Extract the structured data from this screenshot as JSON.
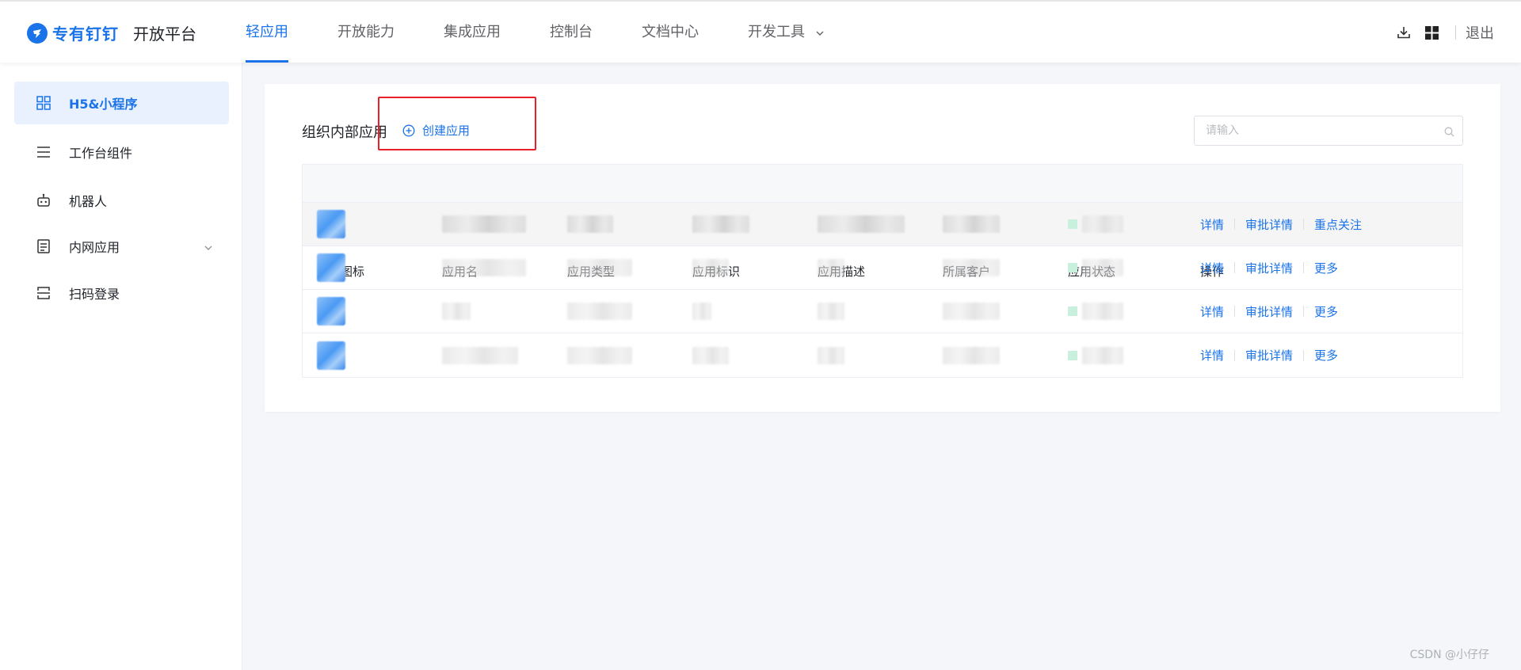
{
  "header": {
    "brand": "专有钉钉",
    "platform": "开放平台",
    "nav": [
      {
        "label": "轻应用",
        "active": true
      },
      {
        "label": "开放能力"
      },
      {
        "label": "集成应用"
      },
      {
        "label": "控制台"
      },
      {
        "label": "文档中心"
      },
      {
        "label": "开发工具",
        "has_dropdown": true
      }
    ],
    "right": {
      "icons": [
        "download-icon",
        "app-grid-icon"
      ],
      "logout": "退出"
    }
  },
  "sidebar": {
    "items": [
      {
        "label": "H5&小程序",
        "icon": "grid-icon",
        "active": true
      },
      {
        "label": "工作台组件",
        "icon": "menu-lines-icon"
      },
      {
        "label": "机器人",
        "icon": "robot-icon"
      },
      {
        "label": "内网应用",
        "icon": "document-icon",
        "expandable": true
      },
      {
        "label": "扫码登录",
        "icon": "scan-icon"
      }
    ]
  },
  "main": {
    "section_title": "组织内部应用",
    "create_button": "创建应用",
    "search": {
      "placeholder": "请输入",
      "value": ""
    },
    "table": {
      "columns": [
        "应用图标",
        "应用名",
        "应用类型",
        "应用标识",
        "应用描述",
        "所属客户",
        "应用状态",
        "操作"
      ],
      "rows": [
        {
          "ops": [
            "详情",
            "审批详情",
            "重点关注"
          ]
        },
        {
          "ops": [
            "详情",
            "审批详情",
            "更多"
          ]
        },
        {
          "ops": [
            "详情",
            "审批详情",
            "更多"
          ]
        },
        {
          "ops": [
            "详情",
            "审批详情",
            "更多"
          ]
        }
      ]
    }
  },
  "watermark": "CSDN @小仔仔",
  "colors": {
    "accent": "#1a73e8",
    "highlight_box": "#e8202a",
    "active_bg": "#e8f1fd"
  }
}
